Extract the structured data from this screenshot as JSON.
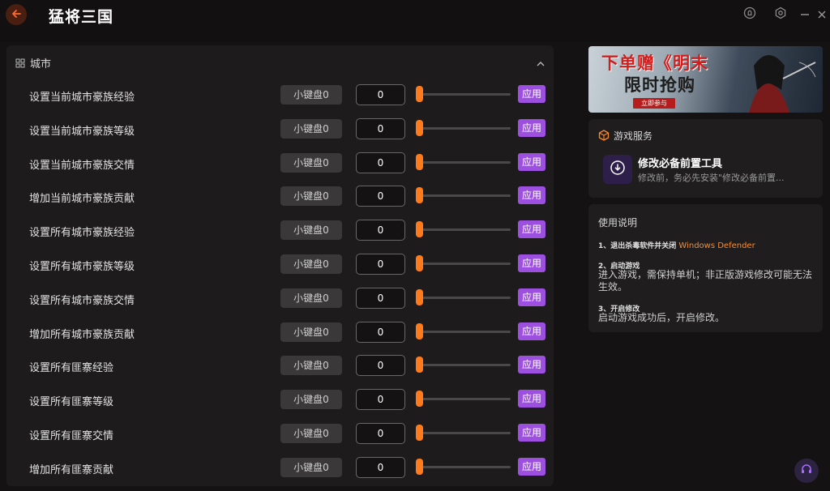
{
  "app": {
    "title": "猛将三国"
  },
  "section": {
    "title": "城市"
  },
  "common": {
    "hotkey_label": "小键盘0",
    "apply_label": "应用"
  },
  "rows": [
    {
      "label": "设置当前城市豪族经验",
      "value": "0"
    },
    {
      "label": "设置当前城市豪族等级",
      "value": "0"
    },
    {
      "label": "设置当前城市豪族交情",
      "value": "0"
    },
    {
      "label": "增加当前城市豪族贡献",
      "value": "0"
    },
    {
      "label": "设置所有城市豪族经验",
      "value": "0"
    },
    {
      "label": "设置所有城市豪族等级",
      "value": "0"
    },
    {
      "label": "设置所有城市豪族交情",
      "value": "0"
    },
    {
      "label": "增加所有城市豪族贡献",
      "value": "0"
    },
    {
      "label": "设置所有匪寨经验",
      "value": "0"
    },
    {
      "label": "设置所有匪寨等级",
      "value": "0"
    },
    {
      "label": "设置所有匪寨交情",
      "value": "0"
    },
    {
      "label": "增加所有匪寨贡献",
      "value": "0"
    }
  ],
  "slider": {
    "level": 0
  },
  "banner": {
    "line1": "下单赠《明末",
    "line2": "限时抢购",
    "cta": "立即参与"
  },
  "service": {
    "header": "游戏服务",
    "name": "修改必备前置工具",
    "desc": "修改前，务必先安装\"修改必备前置..."
  },
  "guide": {
    "title": "使用说明",
    "step1_title": "1、退出杀毒软件并关闭",
    "step1_highlight": "Windows Defender",
    "step2_title": "2、启动游戏",
    "step2_text": "进入游戏，需保持单机；非正版游戏修改可能无法生效。",
    "step3_title": "3、开启修改",
    "step3_text": "启动游戏成功后，开启修改。"
  },
  "colors": {
    "accent": "#ff7a1a",
    "apply": "#9d4fe0",
    "background": "#141212",
    "panel": "#1d1b1b"
  }
}
